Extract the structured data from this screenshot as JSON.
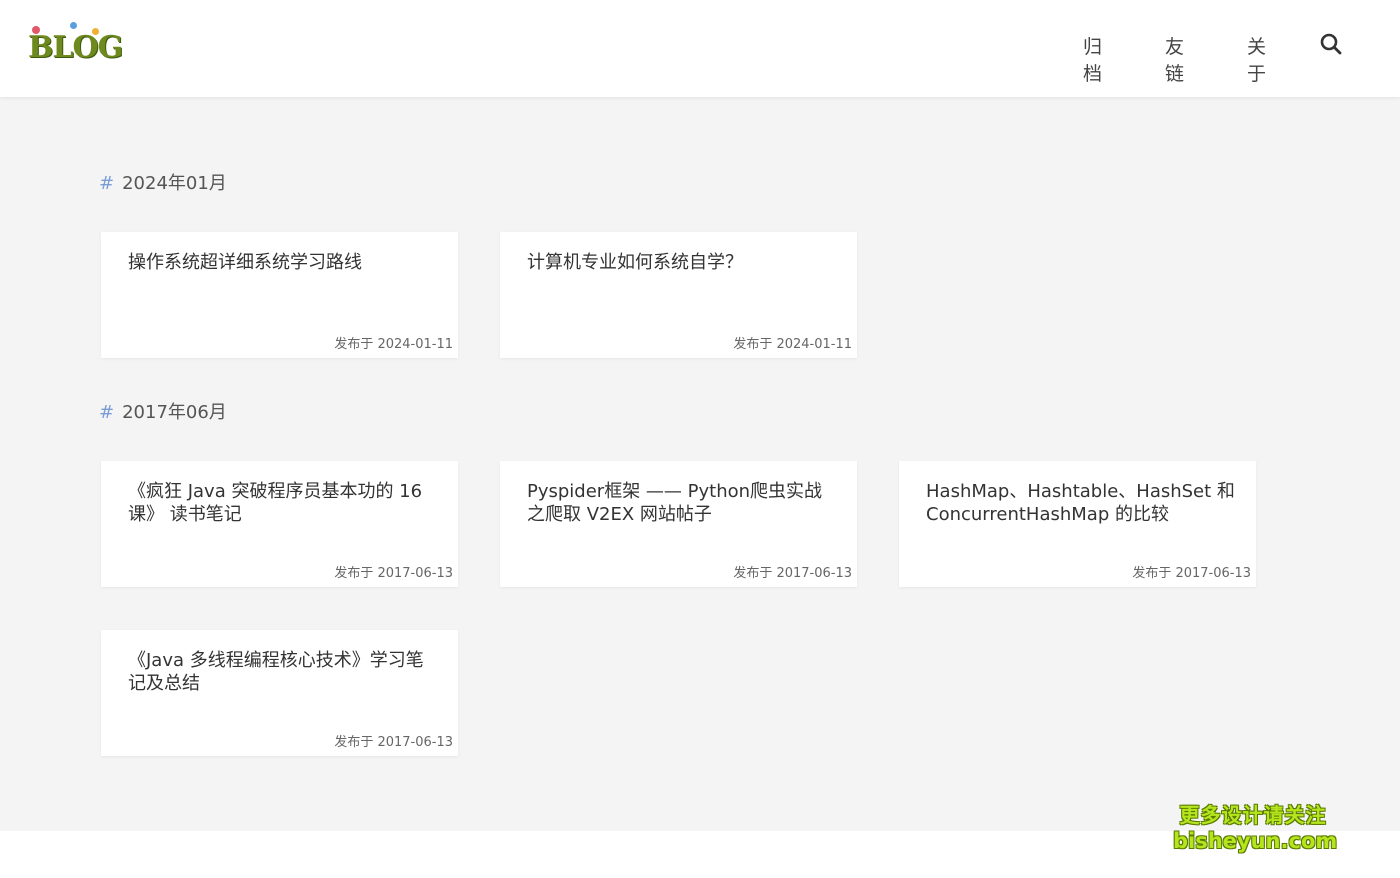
{
  "header": {
    "logo_text": "BLOG",
    "nav": [
      "归档",
      "友链",
      "关于"
    ],
    "search_icon": "search-icon"
  },
  "sections": [
    {
      "hash": "#",
      "title": "2024年01月",
      "posts": [
        {
          "title": "操作系统超详细系统学习路线",
          "date": "发布于 2024-01-11"
        },
        {
          "title": "计算机专业如何系统自学？",
          "date": "发布于 2024-01-11"
        }
      ]
    },
    {
      "hash": "#",
      "title": "2017年06月",
      "posts": [
        {
          "title": "《疯狂 Java 突破程序员基本功的 16 课》 读书笔记",
          "date": "发布于 2017-06-13"
        },
        {
          "title": "Pyspider框架 —— Python爬虫实战之爬取 V2EX 网站帖子",
          "date": "发布于 2017-06-13"
        },
        {
          "title": "HashMap、Hashtable、HashSet 和 ConcurrentHashMap 的比较",
          "date": "发布于 2017-06-13"
        },
        {
          "title": "《Java 多线程编程核心技术》学习笔记及总结",
          "date": "发布于 2017-06-13"
        }
      ]
    }
  ],
  "watermark": {
    "line1": "更多设计请关注",
    "line2": "bisheyun.com"
  },
  "colors": {
    "background": "#f4f4f4",
    "card": "#ffffff",
    "hash_accent": "#7a9dd6",
    "watermark": "#b5e61d"
  }
}
